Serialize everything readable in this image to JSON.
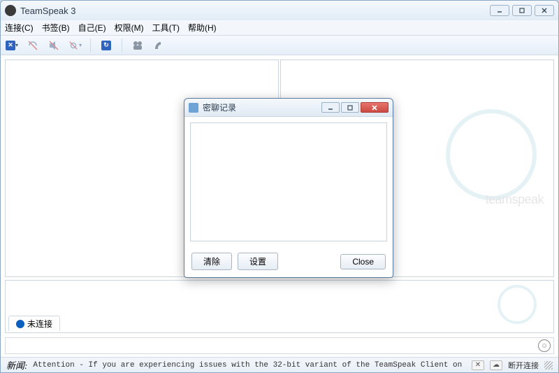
{
  "window": {
    "title": "TeamSpeak 3"
  },
  "menu": {
    "connection": "连接(C)",
    "bookmarks": "书签(B)",
    "self": "自己(E)",
    "permissions": "权限(M)",
    "tools": "工具(T)",
    "help": "帮助(H)"
  },
  "logo": {
    "brand_text": "teamspeak"
  },
  "tabs": {
    "not_connected": "未连接"
  },
  "chat_input": {
    "value": "",
    "placeholder": ""
  },
  "statusbar": {
    "news_label": "新闻:",
    "ticker": "Attention - If you are experiencing issues with the 32-bit variant of the TeamSpeak Client on Window",
    "disconnect": "断开连接"
  },
  "dialog": {
    "title": "密聊记录",
    "clear": "清除",
    "settings": "设置",
    "close": "Close"
  },
  "colors": {
    "accent": "#2e64bd"
  }
}
